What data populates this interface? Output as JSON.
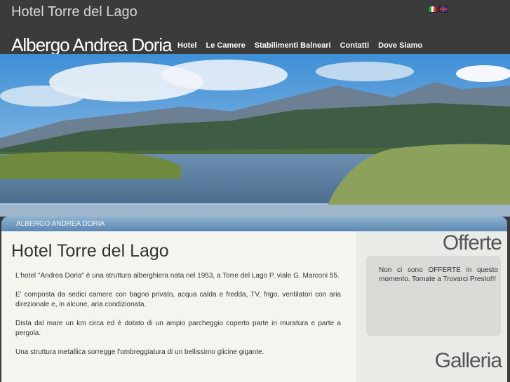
{
  "header": {
    "site_title": "Hotel Torre del Lago",
    "brand": "Albergo Andrea Doria",
    "languages": [
      "Italiano",
      "English"
    ]
  },
  "nav": [
    "Hotel",
    "Le Camere",
    "Stabilimenti Balneari",
    "Contatti",
    "Dove Siamo"
  ],
  "breadcrumb": "ALBERGO ANDREA DORIA",
  "main": {
    "title": "Hotel Torre del Lago",
    "paragraphs": [
      "L'hotel \"Andrea Doria\" è una struttura alberghiera nata nel 1953, a Torre del Lago P. viale G. Marconi 55.",
      "E' composta da sedici camere con bagno privato, acqua calda e fredda, TV, frigo, ventilatori con aria direzionale e, in alcune, aria condizionata.",
      "Dista dal mare un km circa ed è dotato di un ampio parcheggio coperto parte in muratura e parte a pergola.",
      "Una struttura metallica sorregge l'ombreggiatura di un bellissimo glicine gigante."
    ]
  },
  "sidebar": {
    "offerte_title": "Offerte",
    "offerte_text": "Non ci sono OFFERTE in questo momento. Tornate a Trovarci Presto!!!",
    "galleria_title": "Galleria"
  }
}
